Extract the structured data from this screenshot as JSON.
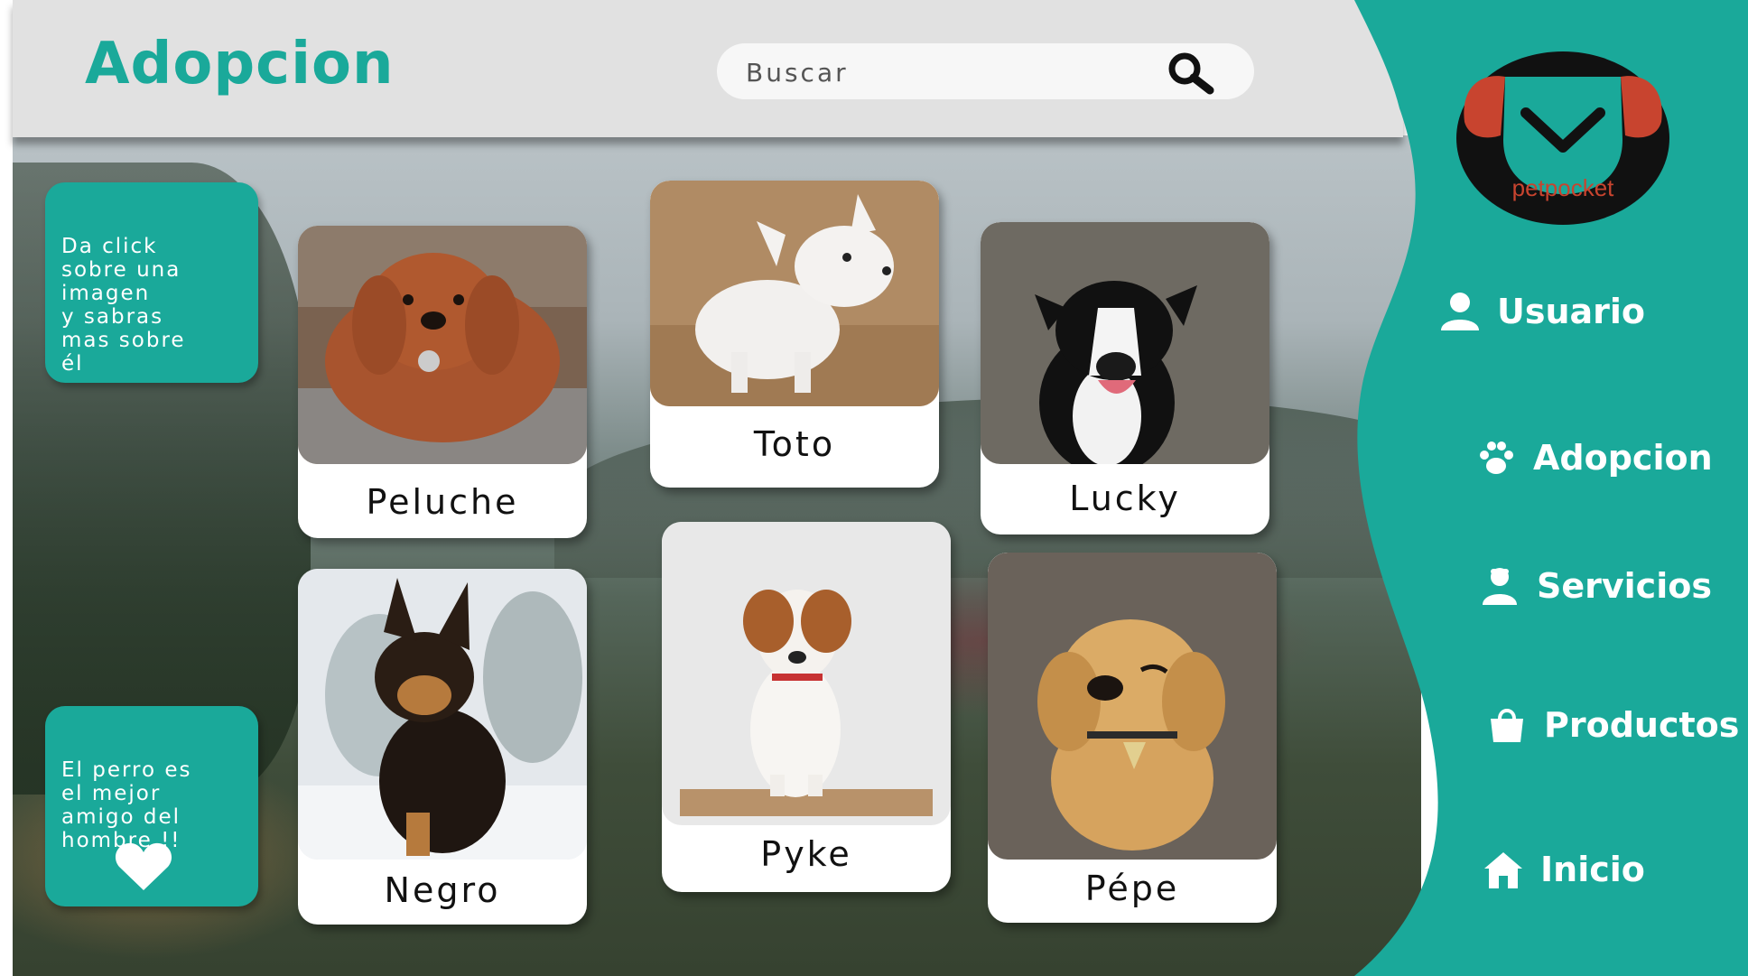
{
  "header": {
    "title": "Adopcion",
    "search_placeholder": "Buscar"
  },
  "brand": {
    "logo_text": "petpocket",
    "accent_color": "#1aa99a",
    "logo_ear_color": "#c8442f"
  },
  "nav": {
    "items": [
      {
        "label": "Usuario",
        "icon": "user-icon"
      },
      {
        "label": "Adopcion",
        "icon": "paw-icon"
      },
      {
        "label": "Servicios",
        "icon": "groomer-icon"
      },
      {
        "label": "Productos",
        "icon": "bag-icon"
      },
      {
        "label": "Inicio",
        "icon": "home-icon"
      }
    ]
  },
  "info_boxes": {
    "top": "Da click\nsobre una\nimagen\ny sabras\nmas sobre\nél",
    "bottom": "El perro es\nel mejor\namigo del\nhombre !!"
  },
  "dogs": [
    {
      "name": "Peluche"
    },
    {
      "name": "Toto"
    },
    {
      "name": "Lucky"
    },
    {
      "name": "Negro"
    },
    {
      "name": "Pyke"
    },
    {
      "name": "Pépe"
    }
  ]
}
